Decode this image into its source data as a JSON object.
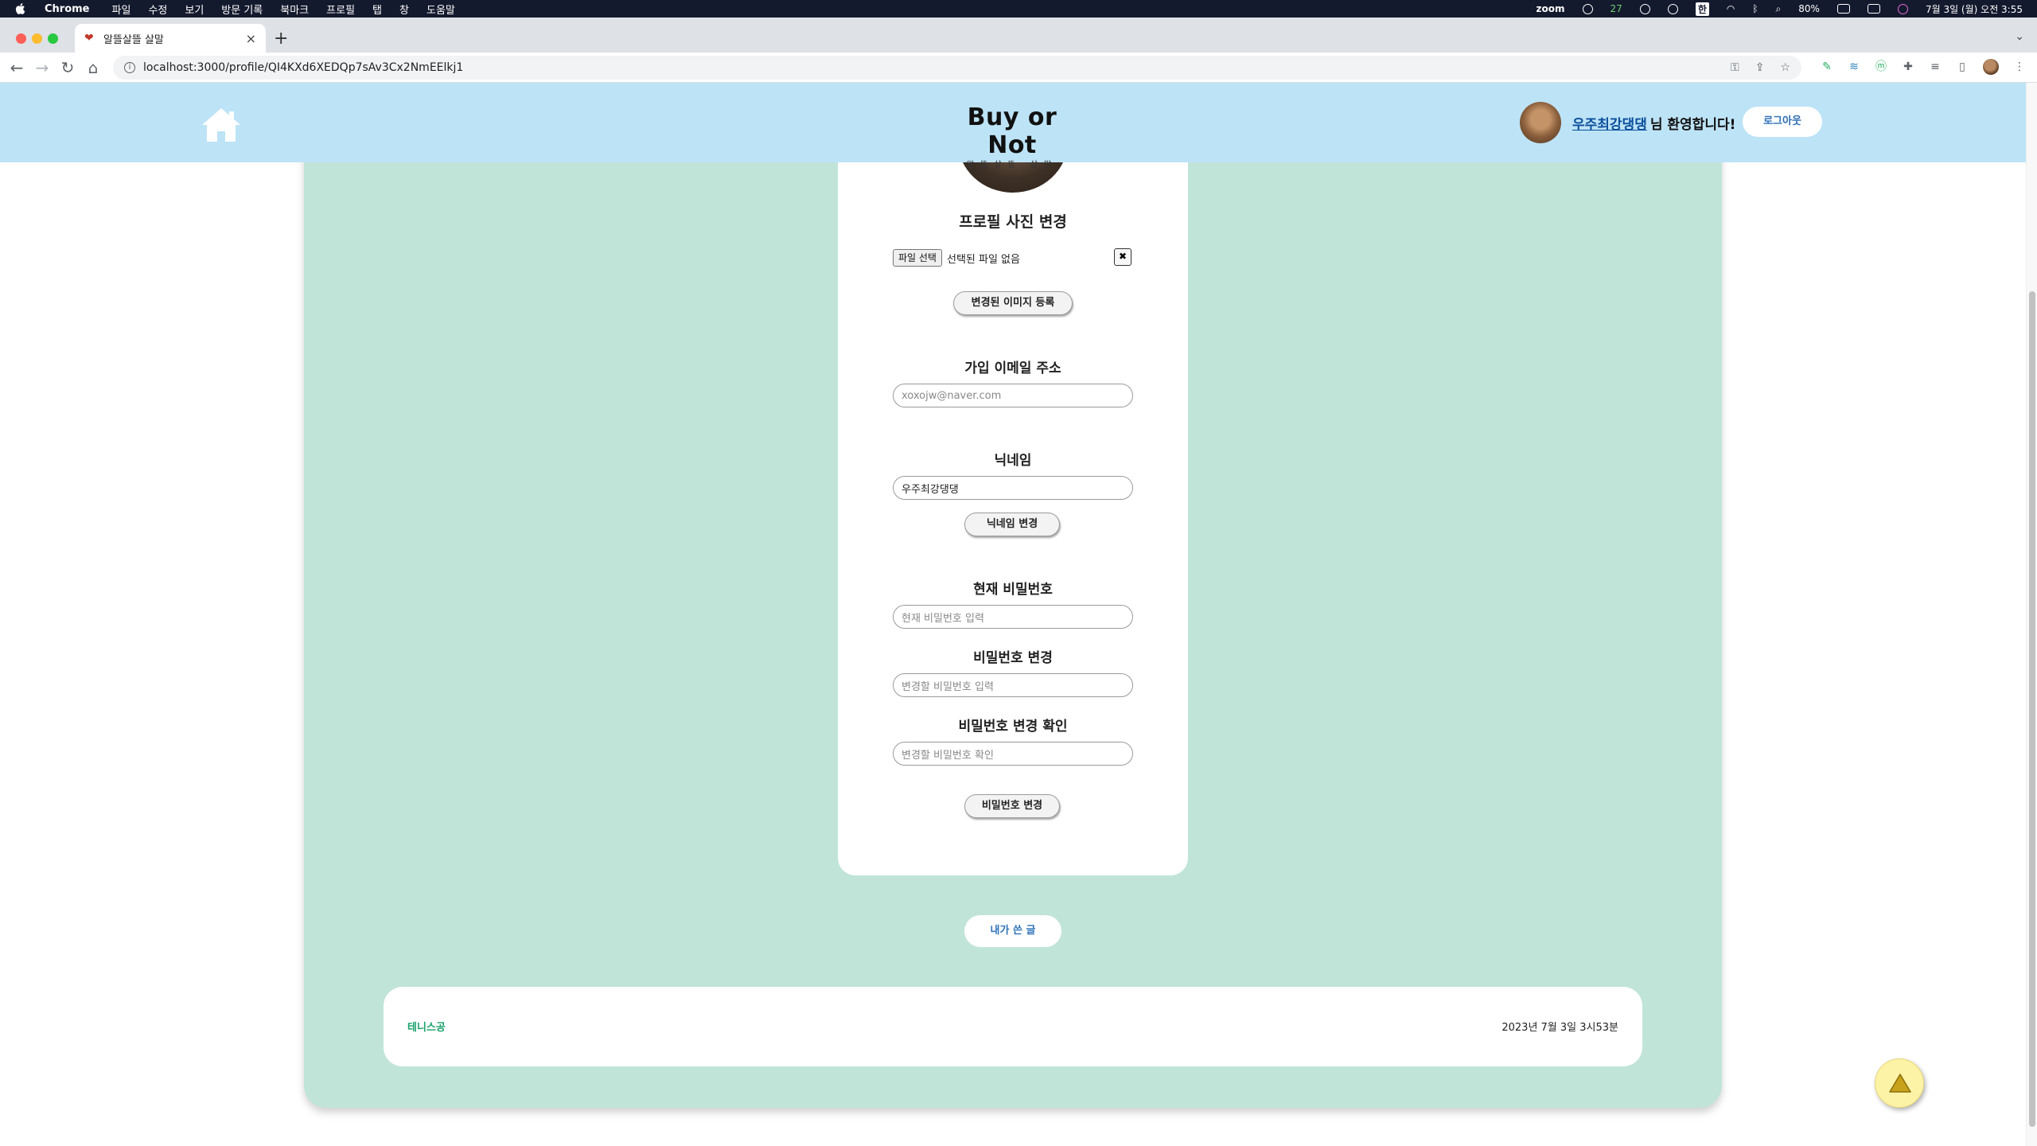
{
  "os_menubar": {
    "app_name": "Chrome",
    "menus": [
      "파일",
      "수정",
      "보기",
      "방문 기록",
      "북마크",
      "프로필",
      "탭",
      "창",
      "도움말"
    ],
    "zoom_label": "zoom",
    "badge_count": "27",
    "input_lang": "한",
    "battery": "80%",
    "datetime": "7월 3일 (월) 오전 3:55"
  },
  "browser": {
    "tab_title": "알뜰살뜰 살말",
    "url": "localhost:3000/profile/QI4KXd6XEDQp7sAv3Cx2NmEElkj1",
    "new_tab": "+",
    "close_tab": "×"
  },
  "header": {
    "logo_main": "Buy or Not",
    "logo_sub": "알뜰살뜰 살말",
    "user_name": "우주최강댕댕",
    "greeting": "님 환영합니다!",
    "logout_label": "로그아웃"
  },
  "profile": {
    "photo_title": "프로필 사진 변경",
    "file_button": "파일 선택",
    "file_status": "선택된 파일 없음",
    "file_clear": "✖",
    "upload_button": "변경된 이미지 등록",
    "email_title": "가입 이메일 주소",
    "email_placeholder": "xoxojw@naver.com",
    "nickname_title": "닉네임",
    "nickname_value": "우주최강댕댕",
    "nickname_button": "닉네임 변경",
    "current_pw_title": "현재 비밀번호",
    "current_pw_placeholder": "현재 비밀번호 입력",
    "new_pw_title": "비밀번호 변경",
    "new_pw_placeholder": "변경할 비밀번호 입력",
    "confirm_pw_title": "비밀번호 변경 확인",
    "confirm_pw_placeholder": "변경할 비밀번호 확인",
    "password_button": "비밀번호 변경"
  },
  "my_posts_button": "내가 쓴 글",
  "posts": [
    {
      "title": "테니스공",
      "date": "2023년 7월 3일 3시53분"
    }
  ],
  "colors": {
    "header_bg": "#bde3f6",
    "main_bg": "#c1e4d9",
    "accent_link": "#2e73b8",
    "post_title": "#1aa26b",
    "top_button": "#fdf3a6"
  }
}
